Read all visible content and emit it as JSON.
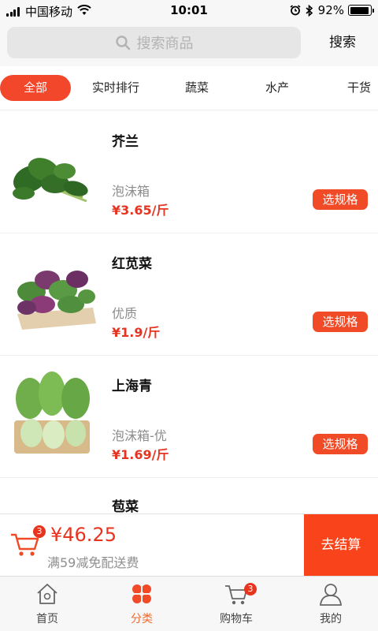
{
  "status_bar": {
    "carrier": "中国移动",
    "time": "10:01",
    "battery_percent": "92%",
    "battery_level": 0.92
  },
  "header": {
    "search_placeholder": "搜索商品",
    "search_button": "搜索"
  },
  "tabs": [
    {
      "label": "全部",
      "active": true
    },
    {
      "label": "实时排行",
      "active": false
    },
    {
      "label": "蔬菜",
      "active": false
    },
    {
      "label": "水产",
      "active": false
    },
    {
      "label": "干货",
      "active": false
    }
  ],
  "products": [
    {
      "name": "芥兰",
      "spec": "泡沫箱",
      "price": "¥3.65/斤",
      "action": "选规格",
      "image": "chinese-kale-image"
    },
    {
      "name": "红苋菜",
      "spec": "优质",
      "price": "¥1.9/斤",
      "action": "选规格",
      "image": "red-amaranth-image"
    },
    {
      "name": "上海青",
      "spec": "泡沫箱-优",
      "price": "¥1.69/斤",
      "action": "选规格",
      "image": "bok-choy-image"
    },
    {
      "name": "苞菜",
      "spec": "",
      "price": "",
      "action": "",
      "image": "cabbage-image"
    }
  ],
  "cart": {
    "count": "3",
    "total": "¥46.25",
    "delivery_note": "满59减免配送费",
    "checkout_label": "去结算"
  },
  "nav": [
    {
      "label": "首页",
      "icon": "home-icon",
      "active": false
    },
    {
      "label": "分类",
      "icon": "category-icon",
      "active": true
    },
    {
      "label": "购物车",
      "icon": "cart-icon",
      "badge": "3",
      "active": false
    },
    {
      "label": "我的",
      "icon": "profile-icon",
      "active": false
    }
  ],
  "colors": {
    "accent": "#f2472b",
    "price": "#e53421",
    "checkout": "#f9431a",
    "nav_active": "#f26a2c"
  }
}
